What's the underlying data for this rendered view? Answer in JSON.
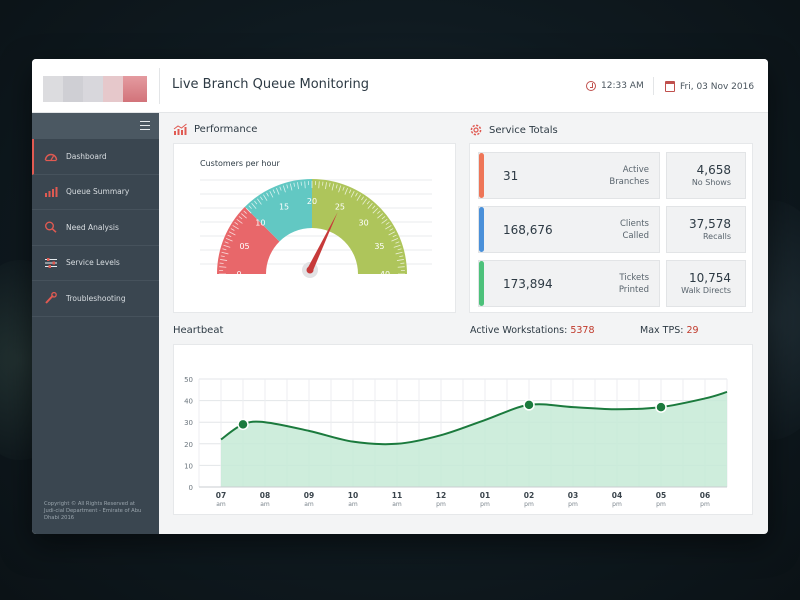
{
  "header": {
    "title": "Live Branch Queue Monitoring",
    "time": "12:33 AM",
    "date": "Fri, 03 Nov 2016"
  },
  "sidebar": {
    "items": [
      {
        "label": "Dashboard",
        "icon": "gauge-icon"
      },
      {
        "label": "Queue Summary",
        "icon": "bar-chart-icon"
      },
      {
        "label": "Need Analysis",
        "icon": "search-icon"
      },
      {
        "label": "Service Levels",
        "icon": "sliders-icon"
      },
      {
        "label": "Troubleshooting",
        "icon": "wrench-icon"
      }
    ],
    "copyright": "Copyright © All Rights Reserved at Judi-cial Department - Emirate of Abu Dhabi 2016"
  },
  "performance": {
    "title": "Performance",
    "subtitle": "Customers per hour",
    "gauge": {
      "ticks": [
        "0",
        "05",
        "10",
        "15",
        "20",
        "25",
        "30",
        "35",
        "40"
      ],
      "min": 0,
      "max": 40,
      "value": 25,
      "segments": [
        {
          "from": 0,
          "to": 10,
          "color": "#e8676a"
        },
        {
          "from": 10,
          "to": 20,
          "color": "#62c8c3"
        },
        {
          "from": 20,
          "to": 40,
          "color": "#aec55b"
        }
      ]
    }
  },
  "service_totals": {
    "title": "Service Totals",
    "rows": [
      {
        "value": "31",
        "label_1": "Active",
        "label_2": "Branches",
        "color": "#ee7557",
        "side_value": "4,658",
        "side_label": "No Shows"
      },
      {
        "value": "168,676",
        "label_1": "Clients",
        "label_2": "Called",
        "color": "#4a90d9",
        "side_value": "37,578",
        "side_label": "Recalls"
      },
      {
        "value": "173,894",
        "label_1": "Tickets",
        "label_2": "Printed",
        "color": "#4cc17a",
        "side_value": "10,754",
        "side_label": "Walk Directs"
      }
    ]
  },
  "heartbeat": {
    "title": "Heartbeat",
    "active_label": "Active Workstations:",
    "active_value": "5378",
    "tps_label": "Max TPS:",
    "tps_value": "29"
  },
  "chart_data": {
    "type": "area",
    "title": "Heartbeat",
    "yticks": [
      0,
      10,
      20,
      30,
      40,
      50
    ],
    "ylim": [
      0,
      50
    ],
    "x_hours": [
      "07",
      "08",
      "09",
      "10",
      "11",
      "12",
      "01",
      "02",
      "03",
      "04",
      "05",
      "06"
    ],
    "x_periods": [
      "am",
      "am",
      "am",
      "am",
      "am",
      "pm",
      "pm",
      "pm",
      "pm",
      "pm",
      "pm",
      "pm"
    ],
    "series": [
      {
        "x": [
          0,
          0.5,
          1,
          2,
          3,
          4,
          5,
          6,
          7,
          8,
          9,
          10,
          11,
          11.5
        ],
        "values": [
          22,
          29,
          30,
          26,
          21,
          20,
          24,
          31,
          38,
          37,
          36,
          37,
          41,
          44
        ]
      }
    ],
    "markers": [
      {
        "x": 0.5,
        "y": 29
      },
      {
        "x": 7,
        "y": 38
      },
      {
        "x": 10,
        "y": 37
      }
    ],
    "grid": true,
    "colors": {
      "line": "#1b7a3d",
      "fill": "#c5ead6"
    }
  }
}
